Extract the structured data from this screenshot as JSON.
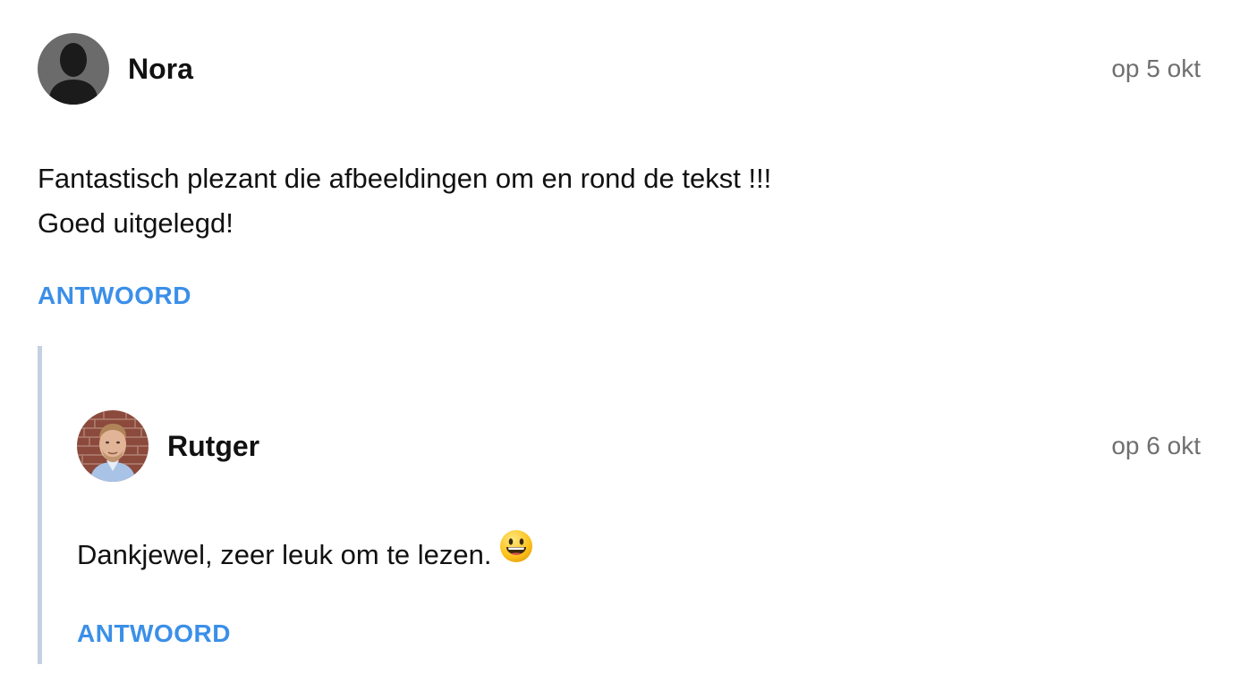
{
  "comments": [
    {
      "author": "Nora",
      "date": "op 5 okt",
      "lines": [
        "Fantastisch plezant die afbeeldingen om en rond de tekst !!!",
        "Goed uitgelegd!"
      ],
      "reply_label": "ANTWOORD",
      "avatar_icon": "default-user-silhouette"
    },
    {
      "author": "Rutger",
      "date": "op 6 okt",
      "text": "Dankjewel, zeer leuk om te lezen.",
      "emoji_icon": "grinning-face-emoji",
      "reply_label": "ANTWOORD",
      "avatar_icon": "user-photo"
    }
  ],
  "colors": {
    "link": "#3b8fe8",
    "date": "#6f6f6f",
    "thread_line": "#c3d1e0"
  }
}
